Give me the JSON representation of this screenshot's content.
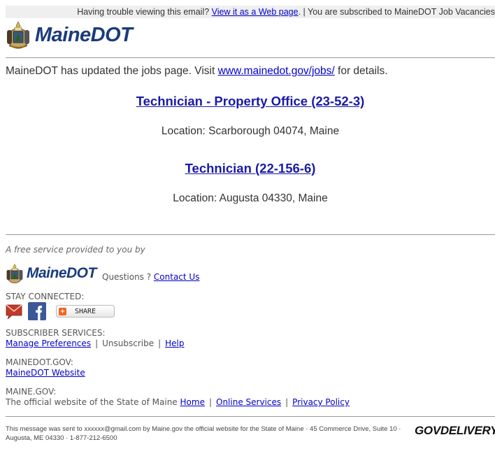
{
  "topbar": {
    "trouble_text": "Having trouble viewing this email? ",
    "web_link": "View it as a Web page",
    "subscribed_text": ". | You are subscribed to MaineDOT Job Vacancies"
  },
  "brand": {
    "name": "MaineDOT",
    "color": "#1b3b7c"
  },
  "intro": {
    "text_before": "MaineDOT has updated the jobs page. Visit ",
    "link": "www.mainedot.gov/jobs/",
    "text_after": " for details."
  },
  "jobs": [
    {
      "title": "Technician - Property Office (23-52-3)",
      "location": "Location: Scarborough 04074, Maine"
    },
    {
      "title": "Technician (22-156-6)",
      "location": "Location: Augusta 04330, Maine"
    }
  ],
  "footer": {
    "free_service": "A free service provided to you by",
    "questions": "Questions ? ",
    "contact_link": "Contact Us",
    "stay_connected": "STAY CONNECTED:",
    "share_label": "SHARE",
    "subscriber_heading": "SUBSCRIBER SERVICES:",
    "manage_prefs": "Manage Preferences",
    "unsubscribe": "Unsubscribe",
    "help": "Help",
    "separator": "|",
    "mainedot_heading": "MAINEDOT.GOV:",
    "mainedot_link": "MaineDOT Website",
    "mainegov_heading": "MAINE.GOV:",
    "mainegov_text": "The official website of the State of Maine ",
    "home": "Home",
    "online_services": "Online Services",
    "privacy_policy": "Privacy Policy"
  },
  "bottom": {
    "message": "This message was sent to xxxxxx@gmail.com by Maine.gov the official website for the State of Maine · 45 Commerce Drive, Suite 10 · Augusta, ME 04330 · 1-877-212-6500",
    "govdelivery": "GOVDELIVERY"
  }
}
